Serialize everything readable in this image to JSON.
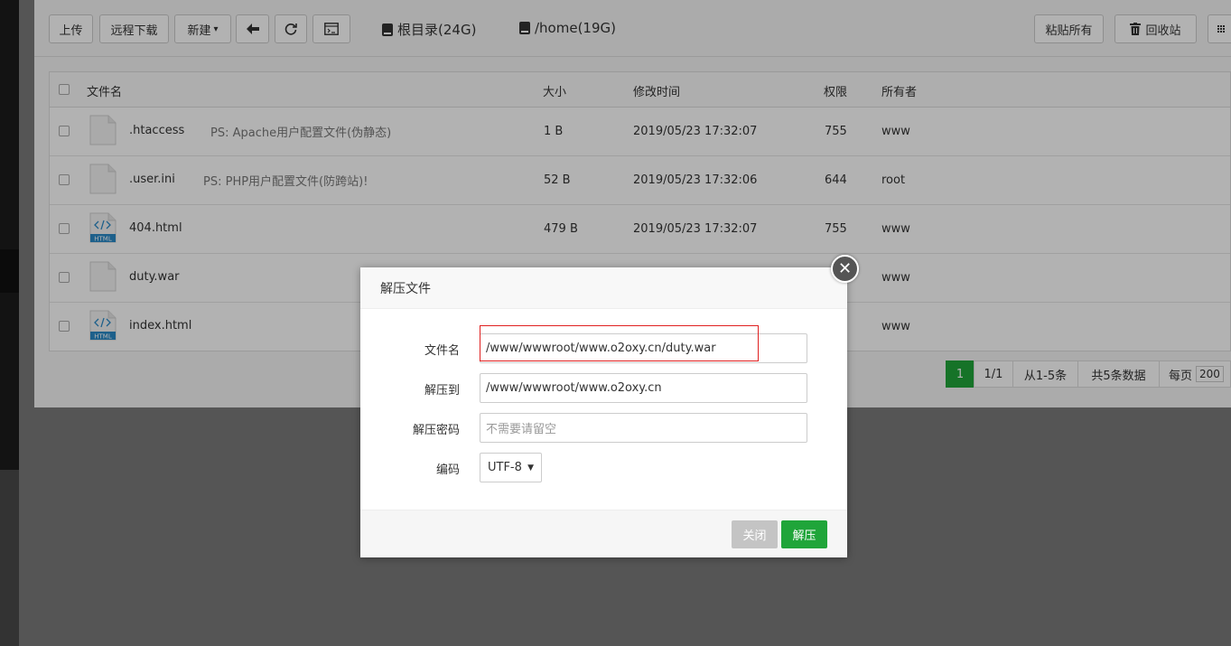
{
  "toolbar": {
    "upload": "上传",
    "remote_download": "远程下载",
    "new": "新建",
    "new_caret": "▾",
    "back_icon": "arrow-left",
    "refresh_icon": "refresh",
    "terminal_icon": "terminal",
    "disk_root": "根目录(24G)",
    "disk_home": "/home(19G)",
    "paste_all": "粘贴所有",
    "recycle_bin": "回收站"
  },
  "table": {
    "headers": {
      "name": "文件名",
      "size": "大小",
      "mtime": "修改时间",
      "perm": "权限",
      "owner": "所有者"
    },
    "rows": [
      {
        "name": ".htaccess",
        "note": "PS: Apache用户配置文件(伪静态)",
        "size": "1 B",
        "mtime": "2019/05/23 17:32:07",
        "perm": "755",
        "owner": "www",
        "icon": "file"
      },
      {
        "name": ".user.ini",
        "note": "PS: PHP用户配置文件(防跨站)!",
        "size": "52 B",
        "mtime": "2019/05/23 17:32:06",
        "perm": "644",
        "owner": "root",
        "icon": "file"
      },
      {
        "name": "404.html",
        "note": "",
        "size": "479 B",
        "mtime": "2019/05/23 17:32:07",
        "perm": "755",
        "owner": "www",
        "icon": "html"
      },
      {
        "name": "duty.war",
        "note": "",
        "size": "",
        "mtime": "",
        "perm": "",
        "owner": "www",
        "icon": "file"
      },
      {
        "name": "index.html",
        "note": "",
        "size": "",
        "mtime": "",
        "perm": "",
        "owner": "www",
        "icon": "html"
      }
    ]
  },
  "pager": {
    "current": "1",
    "pages": "1/1",
    "range": "从1-5条",
    "total": "共5条数据",
    "per_page_label": "每页",
    "per_page_value": "200"
  },
  "dialog": {
    "title": "解压文件",
    "filename_label": "文件名",
    "filename_value": "/www/wwwroot/www.o2oxy.cn/duty.war",
    "dest_label": "解压到",
    "dest_value": "/www/wwwroot/www.o2oxy.cn",
    "password_label": "解压密码",
    "password_placeholder": "不需要请留空",
    "encoding_label": "编码",
    "encoding_value": "UTF-8",
    "close_button": "关闭",
    "extract_button": "解压",
    "close_icon": "✕"
  },
  "icon_file_label": "HTML"
}
